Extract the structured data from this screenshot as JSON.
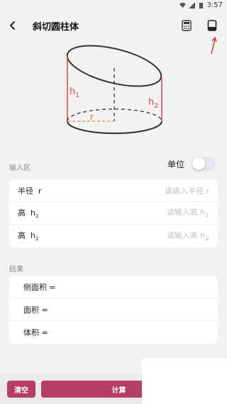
{
  "status": {
    "time": "3:57"
  },
  "header": {
    "title": "斜切圆柱体"
  },
  "figure": {
    "labels": {
      "h1": "h",
      "h1_sub": "1",
      "h2": "h",
      "h2_sub": "2",
      "r": "r"
    },
    "colors": {
      "accent": "#e0453a",
      "stroke": "#333333"
    }
  },
  "input_section": {
    "label": "输入区",
    "unit_label": "单位",
    "unit_toggle_on": false,
    "fields": [
      {
        "label": "半径",
        "symbol": "r",
        "placeholder": "请输入半径",
        "placeholder_symbol": "r"
      },
      {
        "label": "高",
        "symbol": "h",
        "symbol_sub": "1",
        "placeholder": "请输入高",
        "placeholder_symbol": "h",
        "placeholder_sub": "1"
      },
      {
        "label": "高",
        "symbol": "h",
        "symbol_sub": "2",
        "placeholder": "请输入高",
        "placeholder_symbol": "h",
        "placeholder_sub": "2"
      }
    ]
  },
  "result_section": {
    "label": "结果",
    "rows": [
      "侧面积 =",
      "面积 =",
      "体积 ="
    ]
  },
  "actions": {
    "clear_label": "清空",
    "calc_label": "计算",
    "accent": "#b53d63"
  }
}
